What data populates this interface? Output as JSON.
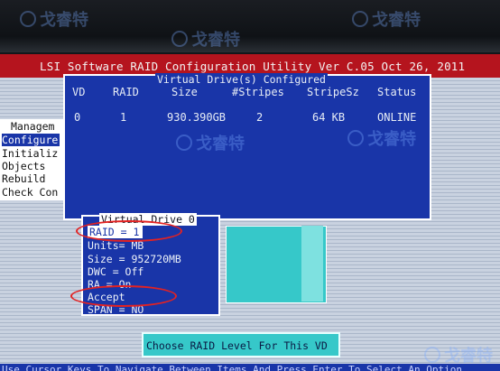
{
  "title": "LSI Software RAID Configuration Utility  Ver C.05 Oct 26, 2011",
  "management_menu": {
    "title": "Managem",
    "items": [
      "Configure",
      "Initializ",
      "Objects",
      "Rebuild",
      "Check Con"
    ],
    "selected": "Configure"
  },
  "configured_panel": {
    "title": "Virtual Drive(s) Configured",
    "columns": [
      "VD",
      "RAID",
      "Size",
      "#Stripes",
      "StripeSz",
      "Status"
    ],
    "rows": [
      {
        "vd": "0",
        "raid": "1",
        "size": "930.390GB",
        "stripes": "2",
        "stripe_sz": "64  KB",
        "status": "ONLINE"
      }
    ]
  },
  "popup": {
    "title": "Virtual Drive 0",
    "items": {
      "raid": "RAID = 1",
      "units": "Units= MB",
      "size": "Size = 952720MB",
      "dwc": "DWC  = Off",
      "ra": "RA   = On",
      "accept": "Accept",
      "span": "SPAN = NO"
    },
    "selected": "RAID = 1"
  },
  "status_message": "Choose RAID Level For This VD",
  "help_line": "Use Cursor Keys To Navigate Between Items And Press Enter To Select An Option",
  "watermark": "戈睿特",
  "colors": {
    "title_bar": "#b5141e",
    "panel_blue": "#1935a8",
    "cyan": "#36c8c9",
    "annotation_red": "#e32222"
  }
}
